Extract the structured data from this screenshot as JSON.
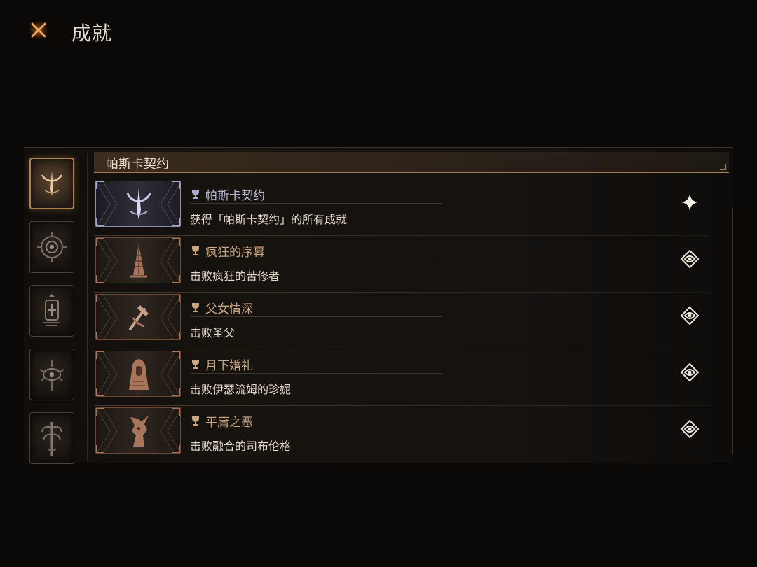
{
  "header": {
    "title": "成就"
  },
  "colors": {
    "accent": "#b08250",
    "locked_title": "#c9a583",
    "unlocked_title": "#b9b9d8"
  },
  "sidebar": {
    "tabs": [
      {
        "icon": "crescent-emblem-icon",
        "active": true
      },
      {
        "icon": "spiral-eye-emblem-icon",
        "active": false
      },
      {
        "icon": "lantern-emblem-icon",
        "active": false
      },
      {
        "icon": "thorned-eye-emblem-icon",
        "active": false
      },
      {
        "icon": "tree-sigil-emblem-icon",
        "active": false
      }
    ]
  },
  "category": {
    "title": "帕斯卡契约"
  },
  "achievements": [
    {
      "title": "帕斯卡契约",
      "description": "获得「帕斯卡契约」的所有成就",
      "unlocked": true,
      "status_icon": "sparkle-icon",
      "emblem": "crescent-icon"
    },
    {
      "title": "疯狂的序幕",
      "description": "击败疯狂的苦修者",
      "unlocked": false,
      "status_icon": "locked-eye-icon",
      "emblem": "spire-icon"
    },
    {
      "title": "父女情深",
      "description": "击败圣父",
      "unlocked": false,
      "status_icon": "locked-eye-icon",
      "emblem": "hammer-icon"
    },
    {
      "title": "月下婚礼",
      "description": "击败伊瑟流姆的珍妮",
      "unlocked": false,
      "status_icon": "locked-eye-icon",
      "emblem": "hooded-figure-icon"
    },
    {
      "title": "平庸之恶",
      "description": "击败融合的司布伦格",
      "unlocked": false,
      "status_icon": "locked-eye-icon",
      "emblem": "beast-icon"
    }
  ]
}
